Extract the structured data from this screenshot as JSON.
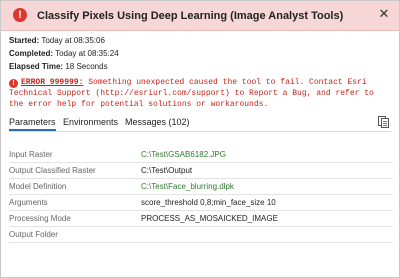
{
  "dialog": {
    "title": "Classify Pixels Using Deep Learning (Image Analyst Tools)",
    "status_icon": "error-circle-icon",
    "close_symbol": "✕"
  },
  "summary": {
    "started_label": "Started:",
    "started_value": "Today at 08:35:06",
    "completed_label": "Completed:",
    "completed_value": "Today at 08:35:24",
    "elapsed_label": "Elapsed Time:",
    "elapsed_value": "18 Seconds"
  },
  "error": {
    "icon": "!",
    "code": "ERROR 999999:",
    "message": " Something unexpected caused the tool to fail. Contact Esri Technical Support (http://esriurl.com/support) to Report a Bug, and refer to the error help for potential solutions or workarounds.",
    "color": "#c4261d"
  },
  "tabs": [
    {
      "label": "Parameters",
      "active": true
    },
    {
      "label": "Environments",
      "active": false
    },
    {
      "label": "Messages (102)",
      "active": false
    }
  ],
  "parameters": [
    {
      "label": "Input Raster",
      "value": "C:\\Test\\GSAB6182.JPG",
      "is_path": true
    },
    {
      "label": "Output Classified Raster",
      "value": "C:\\Test\\Output",
      "is_path": false
    },
    {
      "label": "Model Definition",
      "value": "C:\\Test\\Face_blurring.dlpk",
      "is_path": true
    },
    {
      "label": "Arguments",
      "value": "score_threshold 0,8;min_face_size 10",
      "is_path": false
    },
    {
      "label": "Processing Mode",
      "value": "PROCESS_AS_MOSAICKED_IMAGE",
      "is_path": false
    },
    {
      "label": "Output Folder",
      "value": "",
      "is_path": false
    }
  ]
}
